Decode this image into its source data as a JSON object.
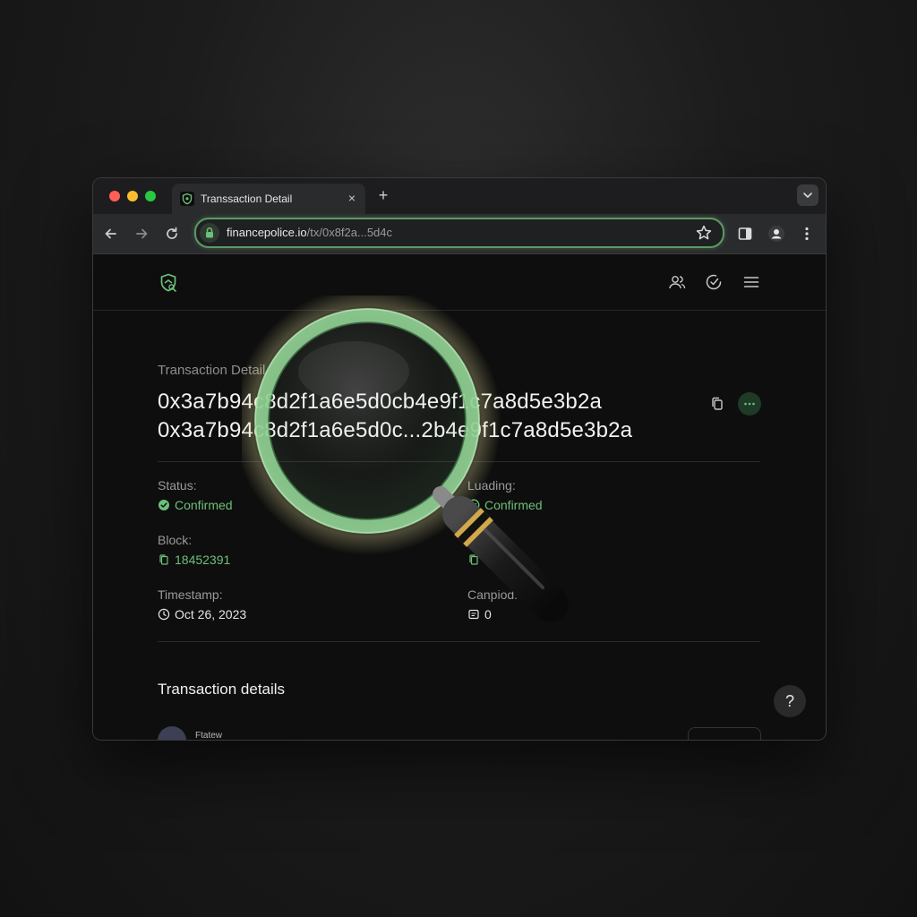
{
  "browser": {
    "tab": {
      "title": "Transsaction Detail"
    },
    "new_tab_label": "+",
    "close_label": "×",
    "address": {
      "host": "financepolice.io",
      "path": "/tx/0x8f2a...5d4c"
    }
  },
  "page": {
    "breadcrumb": "Transaction Detail",
    "hash_line1": "0x3a7b9",
    "hash_line1_b": "4c8d2f1a6e5d0c",
    "hash_line1_c": "b4e9f1c7a8d5e3b2a",
    "hash_line2": "0x3a7b9",
    "hash_line2_b": "4c8d2f1a6e5d0c",
    "hash_line2_c": "...2b4e9f1c7a8d5e3b2a",
    "fields": {
      "status": {
        "label": "Status:",
        "value": "Confirmed"
      },
      "loading": {
        "label": "Luading:",
        "value": "Confirmed"
      },
      "block": {
        "label": "Block:",
        "value": "18452391"
      },
      "timestamp": {
        "label": "Timestamp:",
        "value": "Oct 26, 2023"
      },
      "canpiod": {
        "label": "Canpiod:",
        "value": "0"
      }
    },
    "section_title": "Transaction details",
    "first_row_label": "Ftatew",
    "help_label": "?"
  },
  "colors": {
    "accent": "#6cc07a",
    "background": "#0e0e0e",
    "omnibox_border": "#5b9a64"
  },
  "icons": [
    "shield-favicon-icon",
    "back-arrow-icon",
    "forward-arrow-icon",
    "reload-icon",
    "lock-icon",
    "star-icon",
    "side-panel-icon",
    "profile-icon",
    "kebab-menu-icon",
    "users-icon",
    "clock-check-icon",
    "hamburger-menu-icon",
    "copy-icon",
    "more-icon",
    "check-circle-icon",
    "clock-icon",
    "hash-icon",
    "magnifying-glass-icon"
  ]
}
